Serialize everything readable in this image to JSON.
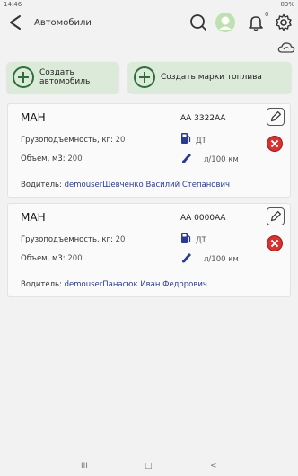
{
  "status": {
    "time": "14:46",
    "battery": "83%"
  },
  "header": {
    "title": "Автомобили",
    "notif_count": "0"
  },
  "actions": {
    "create_car": "Создать автомобиль",
    "create_fuel": "Создать марки топлива"
  },
  "labels": {
    "capacity": "Грузоподъемность, кг:",
    "volume": "Объем, м3:",
    "driver": "Водитель:",
    "consumption": "л/100 км"
  },
  "cars": [
    {
      "name": "МАН",
      "plate": "АА 3322АА",
      "capacity": "20",
      "volume": "200",
      "fuel": "ДТ",
      "driver": "demouserШевченко Василий Степанович"
    },
    {
      "name": "МАН",
      "plate": "АА 0000АА",
      "capacity": "20",
      "volume": "200",
      "fuel": "ДТ",
      "driver": "demouserПанасюк Иван Федорович"
    }
  ],
  "nav": {
    "recents": "III",
    "home": "□",
    "back": "<"
  },
  "colors": {
    "accent": "#2f6e3b",
    "button_bg": "#dcebd9",
    "driver_text": "#2a3b8f",
    "delete": "#d93030"
  }
}
